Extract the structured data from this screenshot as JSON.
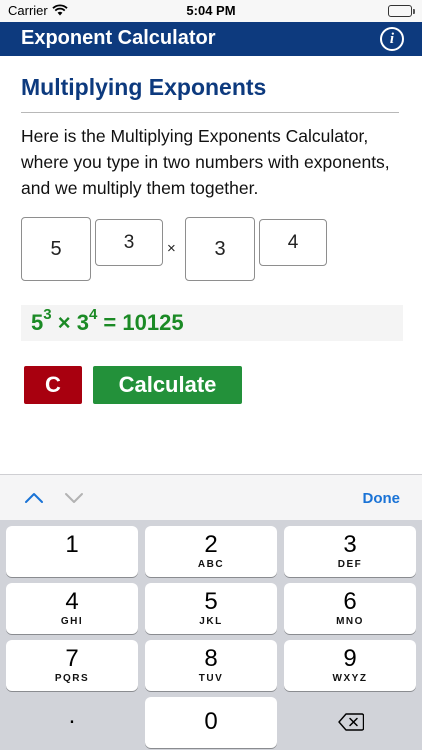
{
  "status_bar": {
    "carrier": "Carrier",
    "time": "5:04 PM"
  },
  "nav": {
    "title": "Exponent Calculator",
    "info_icon": "i"
  },
  "content": {
    "heading": "Multiplying Exponents",
    "description": "Here is the Multiplying Exponents Calculator, where you type in two numbers with exponents, and we multiply them together.",
    "base1": "5",
    "exponent1": "3",
    "operator": "×",
    "base2": "3",
    "exponent2": "4",
    "result": {
      "base1": "5",
      "exp1": "3",
      "op": "×",
      "base2": "3",
      "exp2": "4",
      "equals": "=",
      "value": "10125",
      "color": "#1b8a25"
    },
    "clear_label": "C",
    "calculate_label": "Calculate",
    "colors": {
      "brand": "#0d3a7e",
      "clear": "#a8000f",
      "calculate": "#23913a"
    }
  },
  "keyboard": {
    "done_label": "Done",
    "keys": [
      {
        "number": "1",
        "letters": ""
      },
      {
        "number": "2",
        "letters": "ABC"
      },
      {
        "number": "3",
        "letters": "DEF"
      },
      {
        "number": "4",
        "letters": "GHI"
      },
      {
        "number": "5",
        "letters": "JKL"
      },
      {
        "number": "6",
        "letters": "MNO"
      },
      {
        "number": "7",
        "letters": "PQRS"
      },
      {
        "number": "8",
        "letters": "TUV"
      },
      {
        "number": "9",
        "letters": "WXYZ"
      }
    ],
    "decimal": ".",
    "zero": "0",
    "delete_icon": "delete-backspace-icon"
  }
}
